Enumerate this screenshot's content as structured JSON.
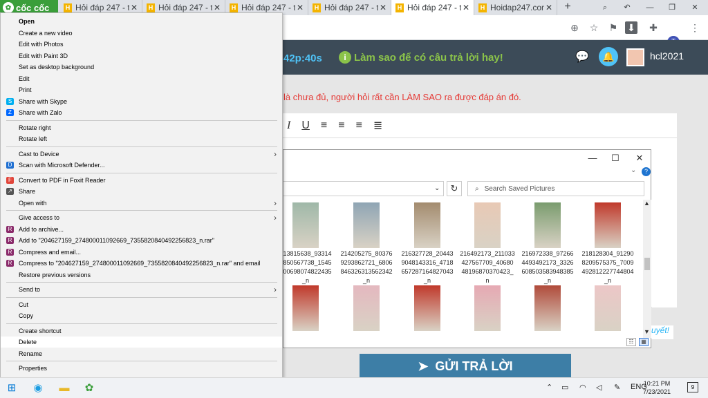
{
  "browser": {
    "brand": "cốc cốc",
    "tabs": [
      {
        "label": "Hỏi đáp 247 - tr",
        "active": false
      },
      {
        "label": "Hỏi đáp 247 - tr",
        "active": false
      },
      {
        "label": "Hỏi đáp 247 - tr",
        "active": false
      },
      {
        "label": "Hỏi đáp 247 - tr",
        "active": false
      },
      {
        "label": "Hỏi đáp 247 - tr",
        "active": true
      },
      {
        "label": "Hoidap247.com",
        "active": false
      }
    ],
    "profile_initial": "T"
  },
  "site": {
    "timer": "42p:40s",
    "howto": "Làm sao để có câu trả lời hay!",
    "username": "hcl2021",
    "notice": "là chưa đủ, người hỏi rất cần LÀM SAO ra được đáp án đó.",
    "submit_label": "GỬI TRẢ LỜI",
    "right_link": "uyết!"
  },
  "dialog": {
    "search_placeholder": "Search Saved Pictures",
    "help": "?",
    "files": [
      {
        "name": "213815638_933142850567738_1545800698074822435_n",
        "color": "#9fb8a8"
      },
      {
        "name": "214205275_803769293862721_6806846326313562342_n",
        "color": "#8fa5b4"
      },
      {
        "name": "216327728_204439048143316_4718657287164827043_n",
        "color": "#a38b6e"
      },
      {
        "name": "216492173_211033427567709_4068048196870370423_n",
        "color": "#e8c9b5"
      },
      {
        "name": "216972338_972664493492173_3326608503583948385_n",
        "color": "#7a9c6e"
      },
      {
        "name": "218128304_912908209575375_7009492812227744804_n",
        "color": "#c0392b"
      },
      {
        "name": "",
        "color": "#c0392b"
      },
      {
        "name": "",
        "color": "#e4b8bf"
      },
      {
        "name": "",
        "color": "#c0392b"
      },
      {
        "name": "",
        "color": "#e6a9b3"
      },
      {
        "name": "",
        "color": "#b04a3a"
      },
      {
        "name": "",
        "color": "#ecc7c7"
      }
    ]
  },
  "context_menu": {
    "items": [
      {
        "label": "Open",
        "bold": true
      },
      {
        "label": "Create a new video"
      },
      {
        "label": "Edit with Photos"
      },
      {
        "label": "Edit with Paint 3D"
      },
      {
        "label": "Set as desktop background"
      },
      {
        "label": "Edit"
      },
      {
        "label": "Print"
      },
      {
        "label": "Share with Skype",
        "icon": "S",
        "icon_color": "#00aff0"
      },
      {
        "label": "Share with Zalo",
        "icon": "Z",
        "icon_color": "#0068ff"
      },
      {
        "sep": true
      },
      {
        "label": "Rotate right"
      },
      {
        "label": "Rotate left"
      },
      {
        "sep": true
      },
      {
        "label": "Cast to Device",
        "submenu": true
      },
      {
        "label": "Scan with Microsoft Defender...",
        "icon": "D",
        "icon_color": "#1f6fd1"
      },
      {
        "sep": true
      },
      {
        "label": "Convert to PDF in Foxit Reader",
        "icon": "F",
        "icon_color": "#e1453a"
      },
      {
        "label": "Share",
        "icon": "↗",
        "icon_color": "#555"
      },
      {
        "label": "Open with",
        "submenu": true
      },
      {
        "sep": true
      },
      {
        "label": "Give access to",
        "submenu": true
      },
      {
        "label": "Add to archive...",
        "icon": "R",
        "icon_color": "#8a2a6a"
      },
      {
        "label": "Add to \"204627159_274800011092669_7355820840492256823_n.rar\"",
        "icon": "R",
        "icon_color": "#8a2a6a"
      },
      {
        "label": "Compress and email...",
        "icon": "R",
        "icon_color": "#8a2a6a"
      },
      {
        "label": "Compress to \"204627159_274800011092669_7355820840492256823_n.rar\" and email",
        "icon": "R",
        "icon_color": "#8a2a6a"
      },
      {
        "label": "Restore previous versions"
      },
      {
        "sep": true
      },
      {
        "label": "Send to",
        "submenu": true
      },
      {
        "sep": true
      },
      {
        "label": "Cut"
      },
      {
        "label": "Copy"
      },
      {
        "sep": true
      },
      {
        "label": "Create shortcut"
      },
      {
        "label": "Delete",
        "highlight": true
      },
      {
        "label": "Rename"
      },
      {
        "sep": true
      },
      {
        "label": "Properties"
      }
    ]
  },
  "taskbar": {
    "lang": "ENG",
    "time": "10:21 PM",
    "date": "7/23/2021",
    "notifications": "9"
  }
}
